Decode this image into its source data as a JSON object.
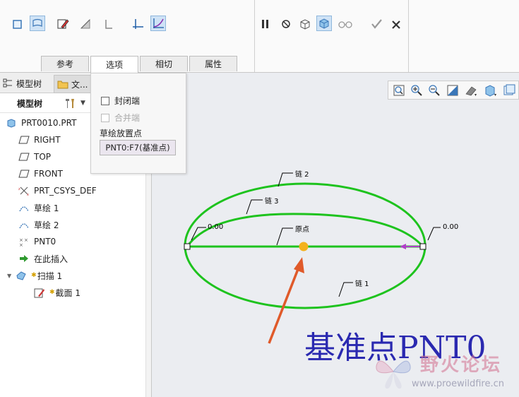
{
  "ribbon": {
    "tabs": [
      {
        "label": "参考"
      },
      {
        "label": "选项",
        "active": true
      },
      {
        "label": "相切"
      },
      {
        "label": "属性"
      }
    ]
  },
  "panel": {
    "tabs": [
      {
        "label": "模型树"
      },
      {
        "label": "文..."
      }
    ],
    "header_label": "模型树",
    "tree": [
      {
        "label": "PRT0010.PRT",
        "icon": "part-icon"
      },
      {
        "label": "RIGHT",
        "icon": "datum-plane-icon"
      },
      {
        "label": "TOP",
        "icon": "datum-plane-icon"
      },
      {
        "label": "FRONT",
        "icon": "datum-plane-icon"
      },
      {
        "label": "PRT_CSYS_DEF",
        "icon": "csys-icon"
      },
      {
        "label": "草绘 1",
        "icon": "sketch-icon"
      },
      {
        "label": "草绘 2",
        "icon": "sketch-icon"
      },
      {
        "label": "PNT0",
        "icon": "datum-point-icon"
      },
      {
        "label": "在此插入",
        "icon": "insert-arrow-icon"
      },
      {
        "label": "扫描 1",
        "icon": "sweep-icon"
      },
      {
        "label": "截面 1",
        "icon": "section-icon"
      }
    ]
  },
  "options_popup": {
    "close_ends_label": "封闭端",
    "merge_ends_label": "合并端",
    "sketch_placement_label": "草绘放置点",
    "placement_value": "PNT0:F7(基准点)"
  },
  "viewport": {
    "annotations": {
      "chain2": "链 2",
      "chain3": "链 3",
      "chain1": "链 1",
      "origin": "原点",
      "left_value": "0.00",
      "right_value": "0.00"
    },
    "big_label": "基准点PNT0",
    "colors": {
      "trajectory": "#1ec31e",
      "origin_point": "#f3b21d",
      "pointer_arrow": "#e05a2a",
      "direction_arrow": "#b040c8",
      "big_label": "#2a29b0"
    }
  },
  "watermark": {
    "title": "野火论坛",
    "url": "www.proewildfire.cn"
  }
}
